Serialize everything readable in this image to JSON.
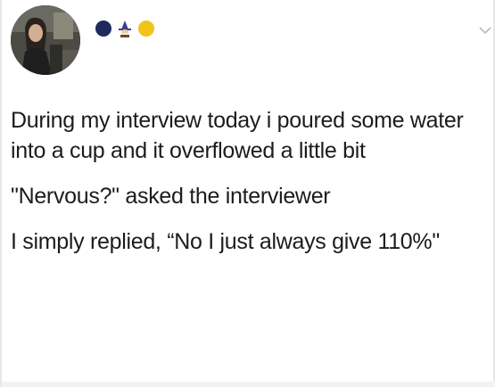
{
  "post": {
    "avatar_icon": "profile-photo",
    "name_emojis": [
      "dark-blue-circle-icon",
      "wizard-icon",
      "yellow-circle-icon"
    ],
    "menu_icon": "chevron-down-icon",
    "paragraphs": [
      "During my interview today i poured some water into a cup and it overflowed a little bit",
      "\"Nervous?\" asked the interviewer",
      "I simply replied, “No I just always give 110%\""
    ]
  },
  "colors": {
    "text": "#1c1c1c",
    "background": "#ffffff",
    "chevron": "#b8bcc0",
    "emoji_blue": "#1f2a5c",
    "emoji_yellow": "#f2c319"
  }
}
